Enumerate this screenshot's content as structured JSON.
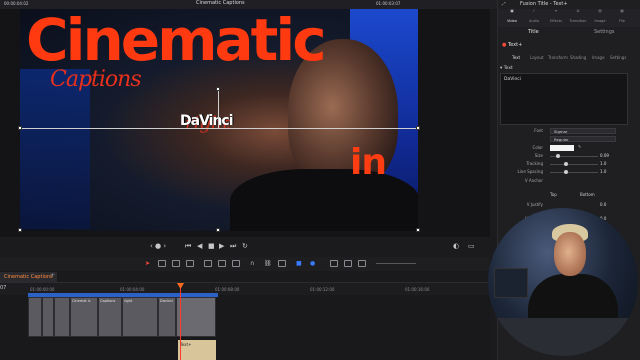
{
  "topbar": {
    "timecode_left": "00:00:04:02",
    "project_title": "Cinematic Captions",
    "timecode_right": "01:00:03:07"
  },
  "viewer": {
    "titles": {
      "main": "Cinematic",
      "sub": "Captions",
      "right_word": "right",
      "davinci_word": "DaVinci",
      "in_word": "in"
    }
  },
  "transport": {
    "buttons": [
      "first-frame",
      "prev-frame",
      "stop",
      "play",
      "next-frame",
      "last-frame",
      "loop"
    ]
  },
  "timeline": {
    "tab_label": "Cinematic Captions",
    "track_timecode": "07",
    "ruler_labels": [
      "01:00:00:00",
      "01:00:04:00",
      "01:00:08:00",
      "01:00:12:00",
      "01:00:16:00"
    ],
    "clips": [
      {
        "label": "Cinemat ic"
      },
      {
        "label": "Captions"
      },
      {
        "label": "right"
      },
      {
        "label": "Davinci"
      }
    ],
    "audio_clip": "Text+"
  },
  "inspector": {
    "title": "Fusion Title - Text+",
    "tabs": [
      "Video",
      "Audio",
      "Effects",
      "Transition",
      "Image",
      "File"
    ],
    "subtabs": [
      "Title",
      "Settings"
    ],
    "node_name": "Text+",
    "node_tabs": [
      "Text",
      "Layout",
      "Transform",
      "Shading",
      "Image",
      "Settings"
    ],
    "section": "Text",
    "styled_text": "DaVinci",
    "font": {
      "label": "Font",
      "family": "Sigmar",
      "style": "Regular"
    },
    "color_label": "Color",
    "accent_colors": {
      "text_color": "#f4f4f4",
      "brand_orange": "#ff3a10",
      "playhead": "#ff3a2a"
    },
    "params": [
      {
        "label": "Size",
        "value": "0.09",
        "fraction": 0.12
      },
      {
        "label": "Tracking",
        "value": "1.0",
        "fraction": 0.3
      },
      {
        "label": "Line Spacing",
        "value": "1.0",
        "fraction": 0.3
      }
    ],
    "v_anchor": {
      "label": "V Anchor",
      "options": [
        "Top",
        "Bottom"
      ]
    },
    "h_anchor": {
      "label": "H Anchor",
      "value": "0.0"
    },
    "v_justify": {
      "label": "V Justify",
      "value": "0.0"
    }
  }
}
